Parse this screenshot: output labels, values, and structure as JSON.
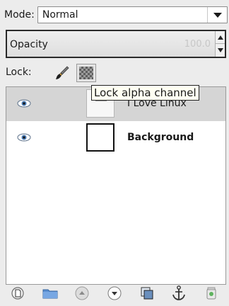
{
  "mode": {
    "label": "Mode:",
    "value": "Normal"
  },
  "opacity": {
    "label": "Opacity",
    "value": "100.0",
    "fraction": 1.0
  },
  "lock": {
    "label": "Lock:",
    "tooltip": "Lock alpha channel"
  },
  "layers": [
    {
      "name": "I Love Linux",
      "visible": true,
      "selected": true
    },
    {
      "name": "Background",
      "visible": true,
      "selected": false
    }
  ],
  "bottom_bar": {
    "icons": [
      "new-layer-icon",
      "new-layer-group-icon",
      "raise-layer-icon",
      "lower-layer-icon",
      "duplicate-layer-icon",
      "anchor-layer-icon",
      "delete-layer-icon"
    ]
  },
  "colors": {
    "accent": "#4a90d9",
    "selected_row": "#d5d5d5",
    "tooltip_bg": "#fffff2"
  }
}
